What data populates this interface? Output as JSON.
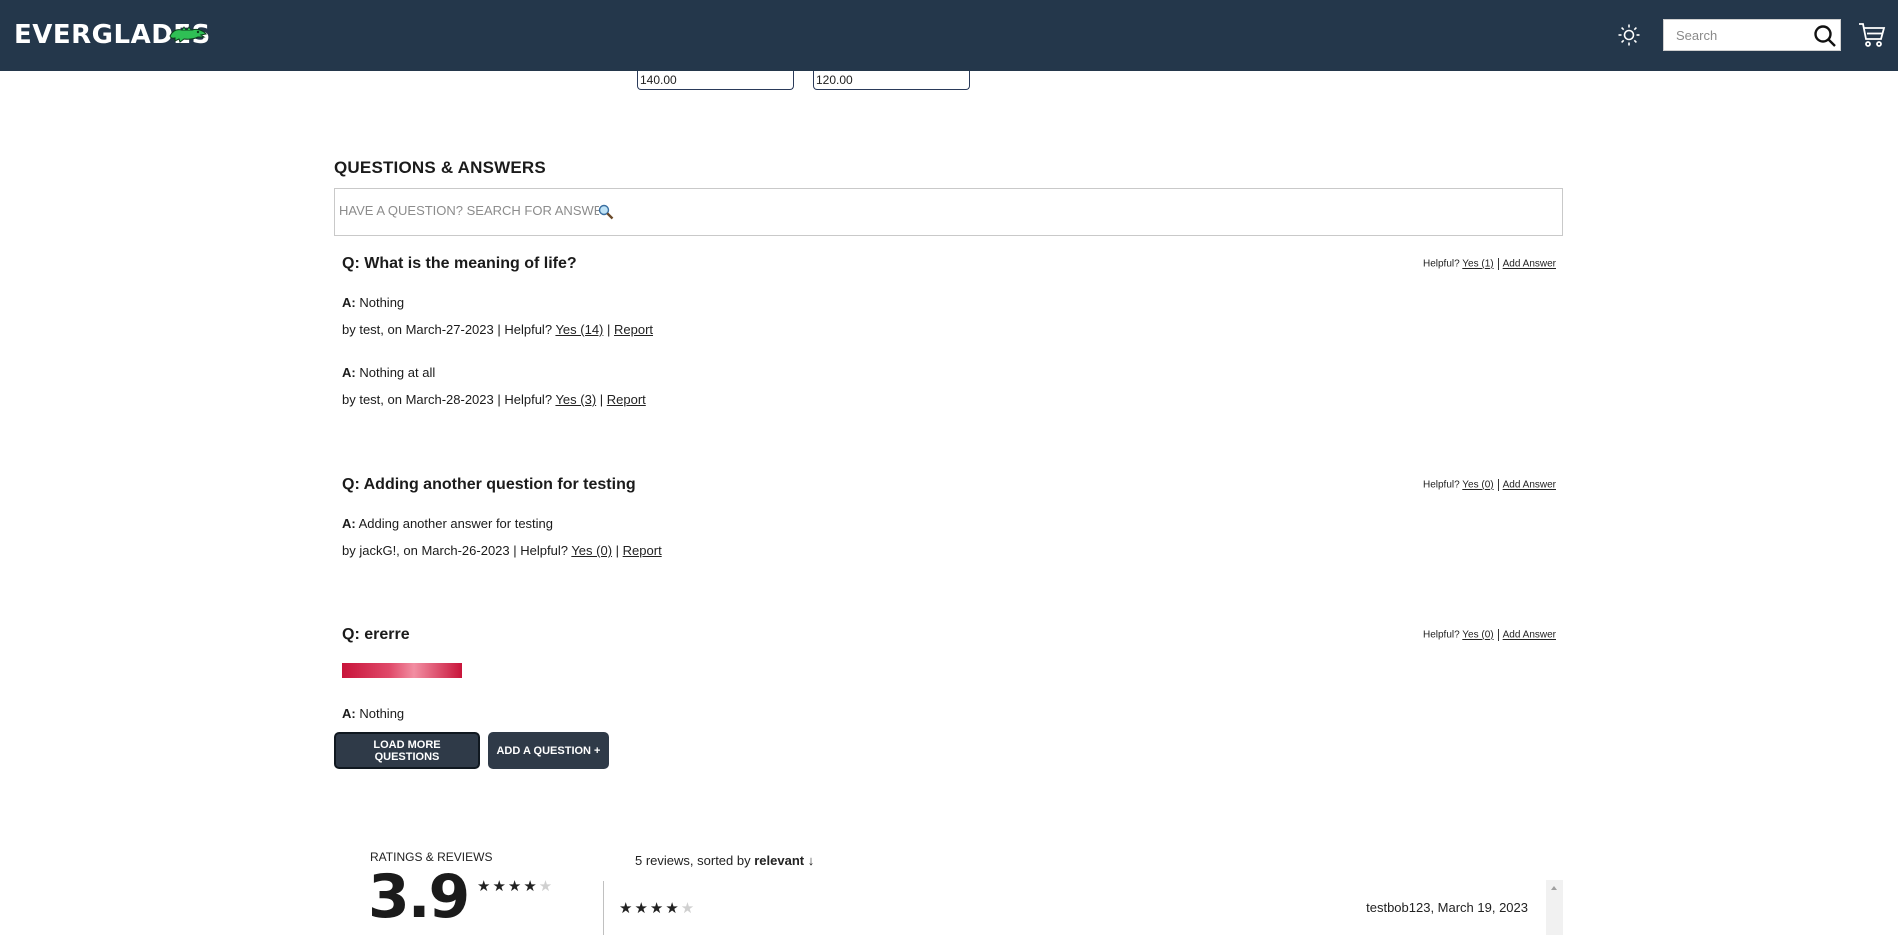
{
  "header": {
    "brand": "EVERGLADES",
    "search_placeholder": "Search",
    "icons": {
      "theme": "sun-icon",
      "search": "search-icon",
      "cart": "cart-icon",
      "logo": "alligator-logo"
    },
    "colors": {
      "bar": "#24374b",
      "logo": "#2fbf55"
    }
  },
  "price_filter": {
    "min": "140.00",
    "max": "120.00"
  },
  "qa": {
    "title": "QUESTIONS & ANSWERS",
    "search_placeholder": "HAVE A QUESTION? SEARCH FOR ANSWERS...",
    "helpful_label": "Helpful?",
    "add_answer_label": "Add Answer",
    "questions": [
      {
        "question": "Q: What is the meaning of life?",
        "helpful_yes": "Yes (1)",
        "answers": [
          {
            "prefix": "A:",
            "text": "Nothing",
            "meta": "by test, on March-27-2023 | Helpful?",
            "yes": "Yes (14)",
            "report": "Report"
          },
          {
            "prefix": "A:",
            "text": "Nothing at all",
            "meta": "by test, on March-28-2023 | Helpful?",
            "yes": "Yes (3)",
            "report": "Report"
          }
        ]
      },
      {
        "question": "Q: Adding another question for testing",
        "helpful_yes": "Yes (0)",
        "answers": [
          {
            "prefix": "A:",
            "text": "Adding another answer for testing",
            "meta": "by jackG!, on March-26-2023 | Helpful?",
            "yes": "Yes (0)",
            "report": "Report"
          }
        ]
      },
      {
        "question": "Q: ererre",
        "helpful_yes": "Yes (0)",
        "answers": [
          {
            "prefix": "A:",
            "text": "Nothing"
          }
        ]
      }
    ],
    "load_more_label": "LOAD MORE QUESTIONS",
    "add_question_label": "ADD A QUESTION +"
  },
  "ratings": {
    "label": "RATINGS & REVIEWS",
    "average": "3.9",
    "average_stars_filled": 4,
    "reviews_count_text": "5 reviews, sorted by",
    "sort_value": "relevant",
    "sort_arrow": "↓",
    "first_review": {
      "stars_filled": 4,
      "user_date": "testbob123, March 19, 2023"
    }
  }
}
